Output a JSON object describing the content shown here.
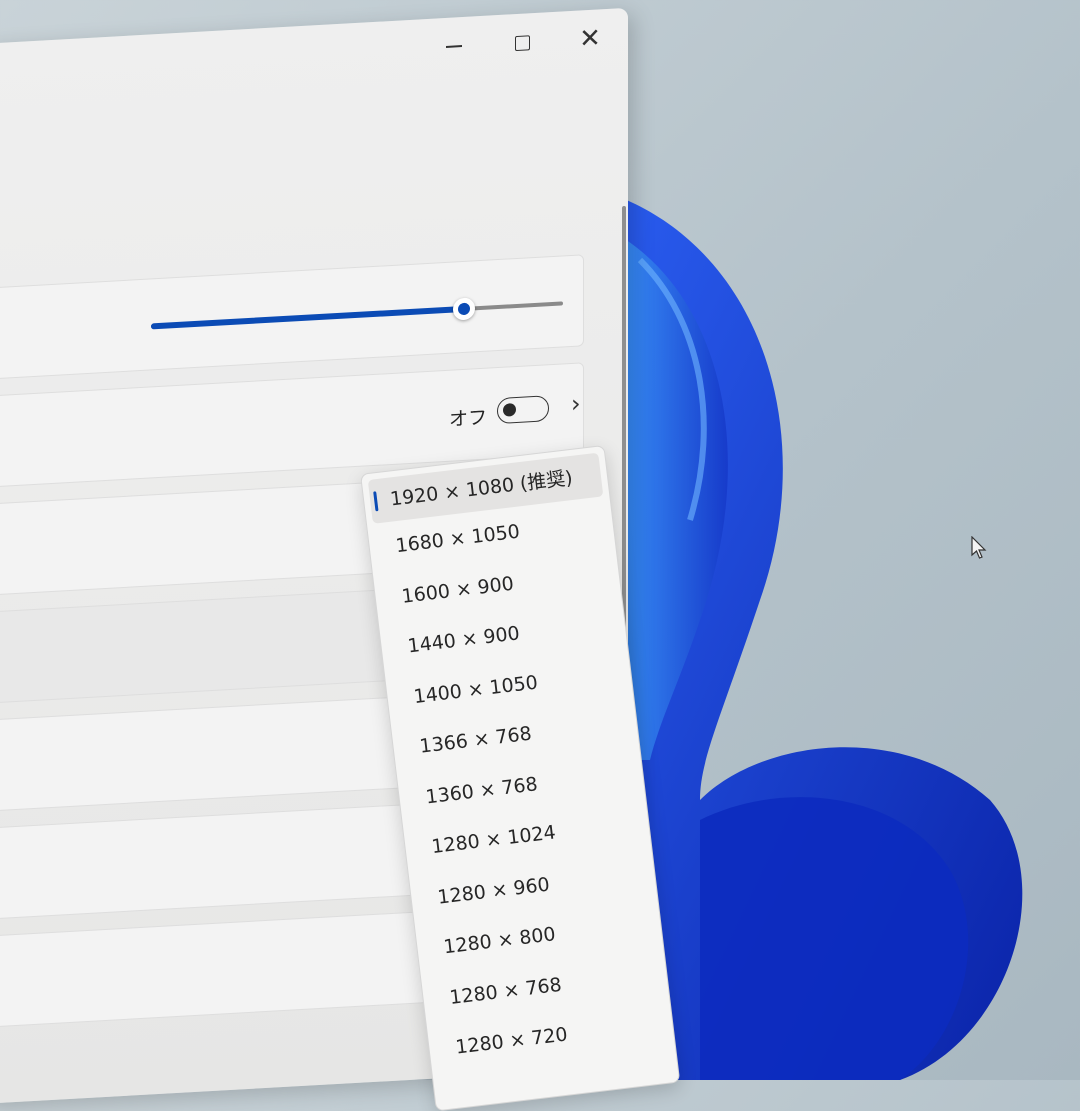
{
  "window": {
    "controls": {
      "minimize": "minimize-icon",
      "maximize": "maximize-icon",
      "close": "close-icon",
      "close_glyph": "✕"
    }
  },
  "brightness_slider": {
    "value_fraction": 0.76
  },
  "night_light": {
    "state_label": "オフ",
    "on": false,
    "chevron": "›"
  },
  "resolution_dropdown": {
    "selected_index": 0,
    "options": [
      "1920 × 1080 (推奨)",
      "1680 × 1050",
      "1600 × 900",
      "1440 × 900",
      "1400 × 1050",
      "1366 × 768",
      "1360 × 768",
      "1280 × 1024",
      "1280 × 960",
      "1280 × 800",
      "1280 × 768",
      "1280 × 720"
    ]
  },
  "colors": {
    "accent": "#0b4bb5",
    "window_bg": "#efefef",
    "desktop_bg": "#b8c5cc",
    "wallpaper_blue": "#1a3fd6"
  }
}
